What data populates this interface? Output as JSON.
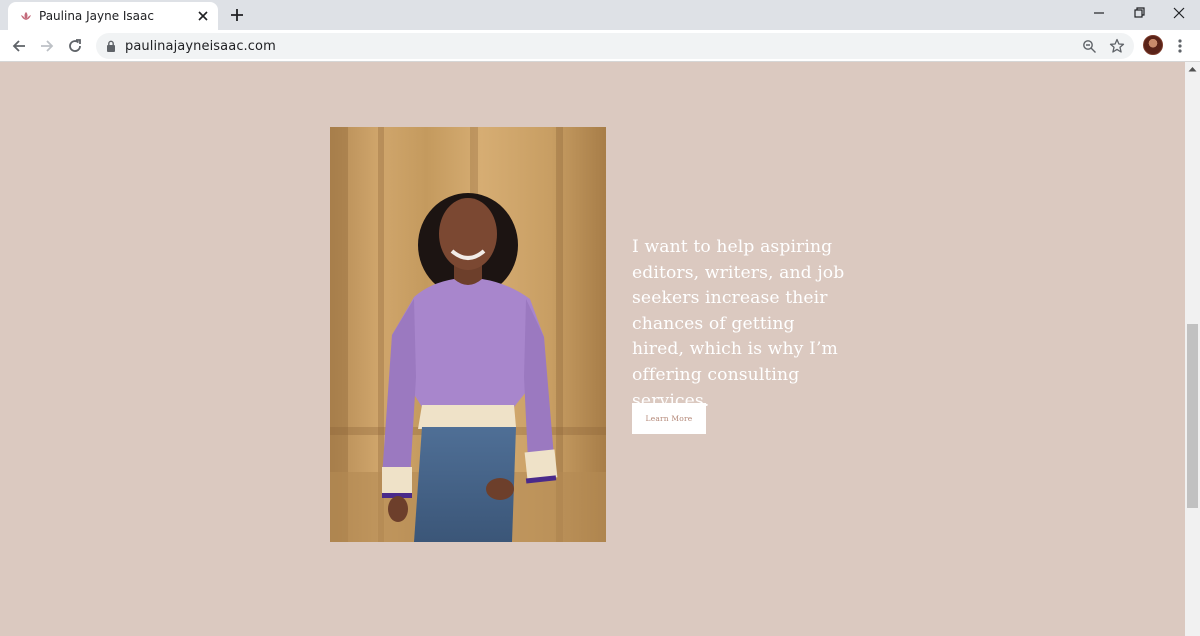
{
  "browser": {
    "tab_title": "Paulina Jayne Isaac",
    "url": "paulinajayneisaac.com"
  },
  "hero": {
    "quote": "I want to help aspiring editors, writers, and job seekers increase their chances of getting hired, which is why I’m offering consulting services.",
    "button_label": "Learn More"
  },
  "colors": {
    "page_background": "#dbc9c0",
    "button_text": "#b48878"
  }
}
